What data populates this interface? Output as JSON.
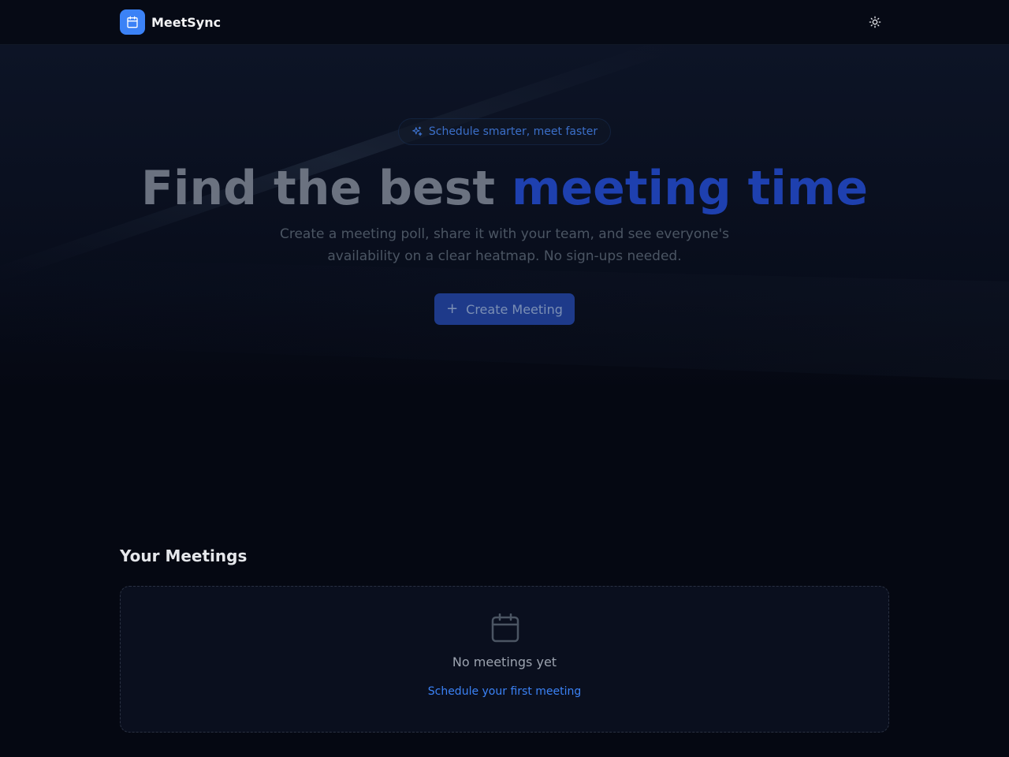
{
  "app": {
    "name": "MeetSync",
    "logo_icon": "calendar-icon",
    "theme_toggle_icon": "sun-icon",
    "accent_color": "#3b82f6"
  },
  "hero": {
    "badge_icon": "sparkles-icon",
    "badge_text": "Schedule smarter, meet faster",
    "title_plain": "Find the best ",
    "title_highlight": "meeting time",
    "subtitle": "Create a meeting poll, share it with your team, and see everyone's availability on a clear heatmap. No sign-ups needed.",
    "cta_icon": "plus-icon",
    "cta_symbol": "+",
    "cta_label": "Create Meeting"
  },
  "meetings": {
    "section_title": "Your Meetings",
    "empty_icon": "calendar-icon",
    "empty_text": "No meetings yet",
    "empty_link": "Schedule your first meeting"
  }
}
